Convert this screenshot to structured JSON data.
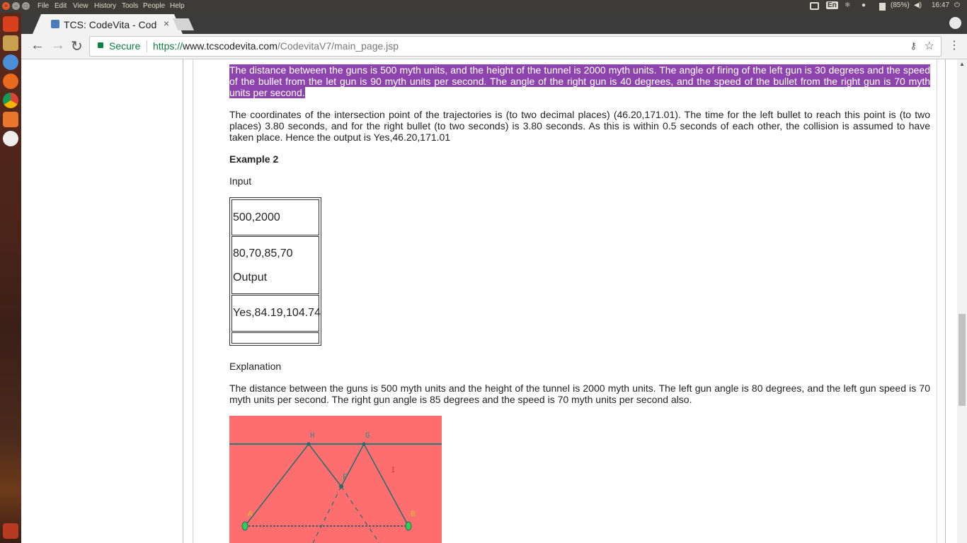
{
  "top_panel": {
    "menus": [
      "File",
      "Edit",
      "View",
      "History",
      "Tools",
      "People",
      "Help"
    ],
    "keyboard": "En",
    "battery": "(85%)",
    "clock": "16:47"
  },
  "browser": {
    "tab_title": "TCS: CodeVita - Cod",
    "tab_close": "×",
    "secure_label": "Secure",
    "url_scheme": "https://",
    "url_domain": "www.tcscodevita.com",
    "url_path": "/CodevitaV7/main_page.jsp"
  },
  "content": {
    "highlighted_para": "The distance between the guns is 500 myth units, and the height of the tunnel is 2000 myth units. The angle of firing of the left gun is 30 degrees and the speed of the bullet from the let gun is 90 myth units per second. The angle of the right gun is 40 degrees, and the speed of the bullet from the right gun is 70 myth units per second.",
    "coords_para": "The coordinates of the intersection point of the trajectories is (to two decimal places) (46.20,171.01). The time for the left bullet to reach this point is (to two places) 3.80 seconds, and for the right bullet (to two seconds) is 3.80 seconds. As this is within 0.5 seconds of each other, the collision is assumed to have taken place. Hence the output is Yes,46.20,171.01",
    "example_heading": "Example 2",
    "input_label": "Input",
    "table": {
      "row1": "500,2000",
      "row2": "80,70,85,70",
      "row2_output": "Output",
      "row3": "Yes,84.19,104.74"
    },
    "explanation_label": "Explanation",
    "explanation_para": "The distance between the guns is 500 myth units and the height of the tunnel is 2000 myth units. The left gun angle is 80 degrees, and the left gun speed is 70 myth units per second. The right gun angle is 85 degrees and the speed is 70 myth units per second also.",
    "diagram_labels": {
      "h": "H",
      "g": "G",
      "i": "I",
      "f": "F",
      "a": "A",
      "b": "B"
    }
  }
}
